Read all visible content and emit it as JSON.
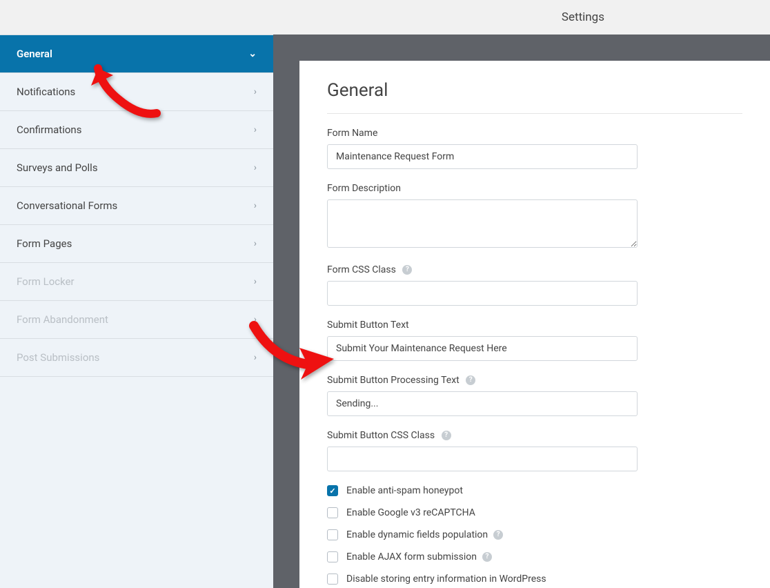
{
  "topbar": {
    "title": "Settings"
  },
  "sidebar": {
    "items": [
      {
        "label": "General",
        "active": true,
        "disabled": false
      },
      {
        "label": "Notifications",
        "active": false,
        "disabled": false
      },
      {
        "label": "Confirmations",
        "active": false,
        "disabled": false
      },
      {
        "label": "Surveys and Polls",
        "active": false,
        "disabled": false
      },
      {
        "label": "Conversational Forms",
        "active": false,
        "disabled": false
      },
      {
        "label": "Form Pages",
        "active": false,
        "disabled": false
      },
      {
        "label": "Form Locker",
        "active": false,
        "disabled": true
      },
      {
        "label": "Form Abandonment",
        "active": false,
        "disabled": true
      },
      {
        "label": "Post Submissions",
        "active": false,
        "disabled": true
      }
    ]
  },
  "panel": {
    "heading": "General",
    "fields": {
      "form_name": {
        "label": "Form Name",
        "value": "Maintenance Request Form"
      },
      "form_description": {
        "label": "Form Description",
        "value": ""
      },
      "form_css_class": {
        "label": "Form CSS Class",
        "value": "",
        "help": true
      },
      "submit_button_text": {
        "label": "Submit Button Text",
        "value": "Submit Your Maintenance Request Here"
      },
      "submit_button_processing": {
        "label": "Submit Button Processing Text",
        "value": "Sending...",
        "help": true
      },
      "submit_button_css_class": {
        "label": "Submit Button CSS Class",
        "value": "",
        "help": true
      }
    },
    "checkboxes": [
      {
        "label": "Enable anti-spam honeypot",
        "checked": true,
        "help": false
      },
      {
        "label": "Enable Google v3 reCAPTCHA",
        "checked": false,
        "help": false
      },
      {
        "label": "Enable dynamic fields population",
        "checked": false,
        "help": true
      },
      {
        "label": "Enable AJAX form submission",
        "checked": false,
        "help": true
      },
      {
        "label": "Disable storing entry information in WordPress",
        "checked": false,
        "help": false
      }
    ]
  }
}
